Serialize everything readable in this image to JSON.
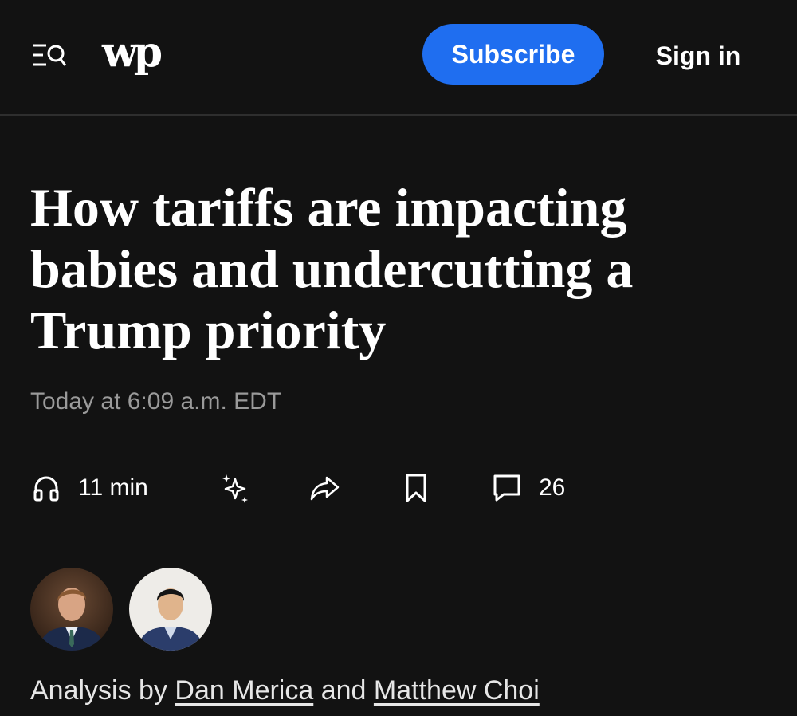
{
  "header": {
    "logo_text": "wp",
    "menu_icon": "menu-search-icon",
    "subscribe_label": "Subscribe",
    "signin_label": "Sign in",
    "accent_color": "#1f6ef0"
  },
  "article": {
    "headline": "How tariffs are impacting babies and undercutting a Trump priority",
    "timestamp": "Today at 6:09 a.m. EDT",
    "actions": {
      "listen_icon": "headphones-icon",
      "listen_label": "11 min",
      "summary_icon": "sparkle-icon",
      "share_icon": "share-icon",
      "save_icon": "bookmark-icon",
      "comments_icon": "comment-icon",
      "comments_count": "26"
    },
    "byline": {
      "prefix": "Analysis by",
      "author1": "Dan Merica",
      "conjunction": "and",
      "author2": "Matthew Choi"
    }
  }
}
